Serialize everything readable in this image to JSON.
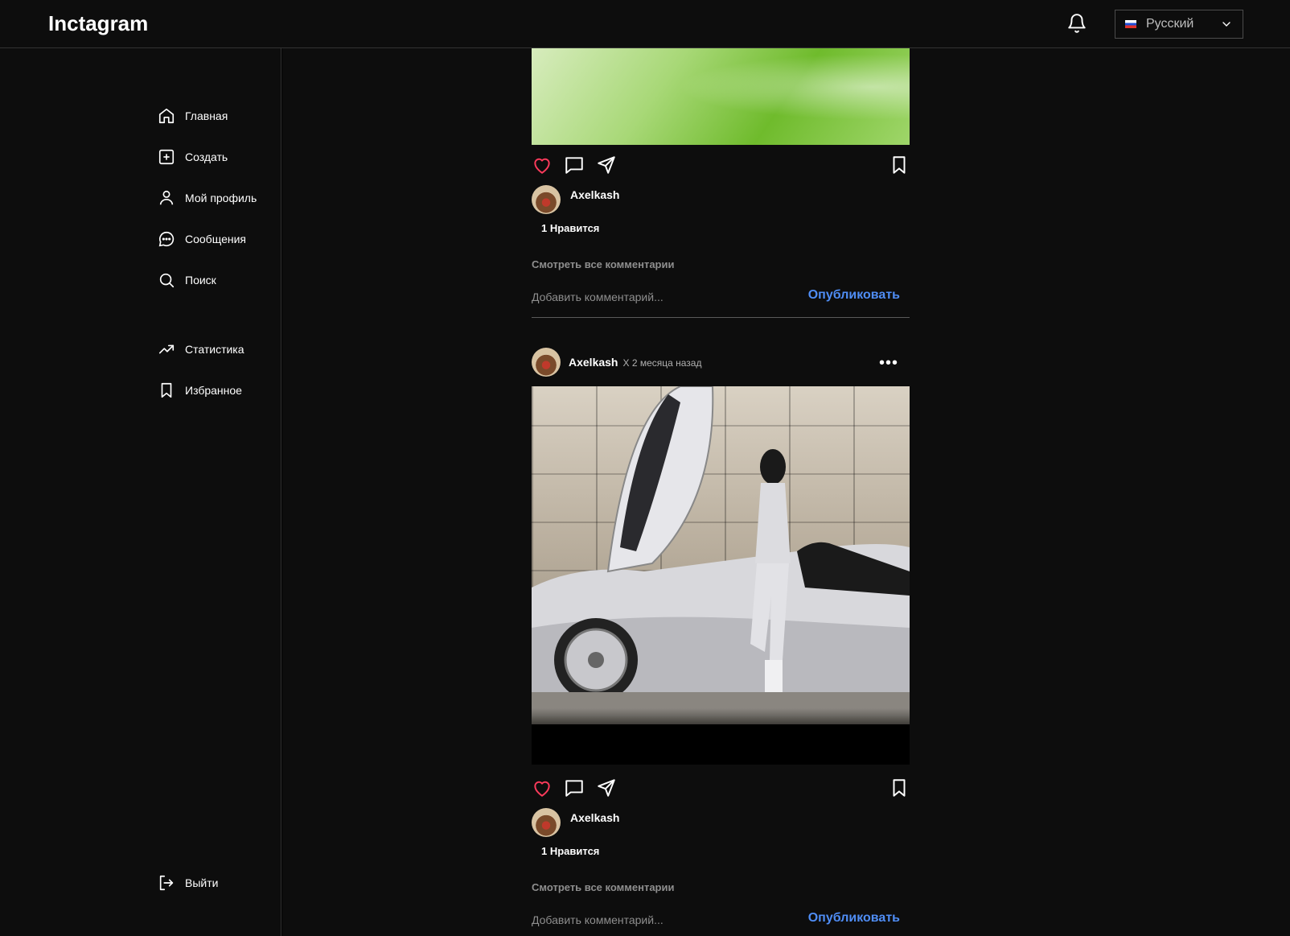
{
  "header": {
    "logo": "Inctagram",
    "language": "Русский"
  },
  "sidebar": {
    "items": [
      {
        "label": "Главная",
        "icon": "home-icon"
      },
      {
        "label": "Создать",
        "icon": "plus-square-icon"
      },
      {
        "label": "Мой профиль",
        "icon": "user-icon"
      },
      {
        "label": "Сообщения",
        "icon": "message-icon"
      },
      {
        "label": "Поиск",
        "icon": "search-icon"
      },
      {
        "label": "Статистика",
        "icon": "trending-up-icon"
      },
      {
        "label": "Избранное",
        "icon": "bookmark-icon"
      }
    ],
    "logout": "Выйти"
  },
  "posts": [
    {
      "username": "Axelkash",
      "likes": "1 Нравится",
      "view_comments": "Смотреть все комментарии",
      "comment_placeholder": "Добавить комментарий...",
      "publish": "Опубликовать"
    },
    {
      "username": "Axelkash",
      "time": "X 2 месяца назад",
      "caption_username": "Axelkash",
      "likes": "1 Нравится",
      "view_comments": "Смотреть все комментарии",
      "comment_placeholder": "Добавить комментарий...",
      "publish": "Опубликовать"
    }
  ],
  "colors": {
    "accent": "#4f8df5",
    "like": "#ff3b5c",
    "background": "#0d0d0d"
  }
}
